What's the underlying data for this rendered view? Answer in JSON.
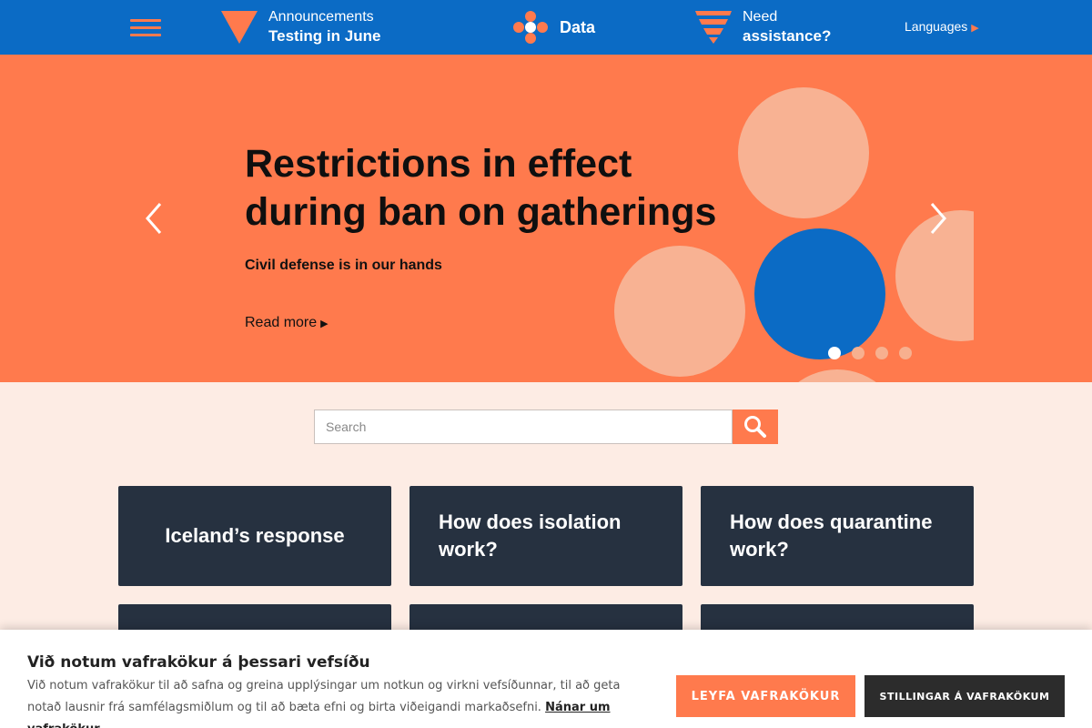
{
  "nav": {
    "announcements_small": "Announcements",
    "announcements_big": "Testing in June",
    "data_label": "Data",
    "help_small": "Need",
    "help_big": "assistance?",
    "languages": "Languages",
    "accent_color": "#ff7a4d",
    "bar_color": "#0b6bc5"
  },
  "hero": {
    "title_line1": "Restrictions in effect",
    "title_line2": "during ban on gatherings",
    "subtitle": "Civil defense is in our hands",
    "read_more": "Read more",
    "slide_count": 4,
    "active_slide": 1
  },
  "search": {
    "placeholder": "Search"
  },
  "cards": [
    {
      "label": "Iceland’s response"
    },
    {
      "label": "How does isolation work?"
    },
    {
      "label": "How does quarantine work?"
    }
  ],
  "cookie": {
    "title": "Við notum vafrakökur á þessari vefsíðu",
    "text": "Við notum vafrakökur til að safna og greina upplýsingar um notkun og virkni vefsíðunnar, til að geta notað lausnir frá samfélagsmiðlum og til að bæta efni og birta viðeigandi markaðsefni.",
    "link": "Nánar um vafrakökur",
    "accept": "LEYFA VAFRAKÖKUR",
    "settings": "STILLINGAR Á VAFRAKÖKUM"
  }
}
